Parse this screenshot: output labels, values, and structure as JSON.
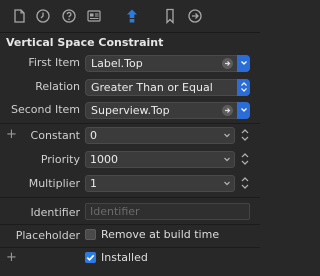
{
  "toolbar": {
    "icons": [
      "file-icon",
      "clock-icon",
      "help-icon",
      "identity-icon",
      "size-icon",
      "attributes-icon",
      "connections-icon"
    ],
    "active": "size-icon",
    "active_color": "#2a7ce0"
  },
  "section": {
    "title": "Vertical Space Constraint"
  },
  "fields": {
    "first_item": {
      "label": "First Item",
      "value": "Label.Top"
    },
    "relation": {
      "label": "Relation",
      "value": "Greater Than or Equal"
    },
    "second_item": {
      "label": "Second Item",
      "value": "Superview.Top"
    },
    "constant": {
      "label": "Constant",
      "value": "0"
    },
    "priority": {
      "label": "Priority",
      "value": "1000"
    },
    "multiplier": {
      "label": "Multiplier",
      "value": "1"
    },
    "identifier": {
      "label": "Identifier",
      "placeholder": "Identifier"
    },
    "placeholder": {
      "label": "Placeholder",
      "checkbox_label": "Remove at build time",
      "checked": false
    },
    "installed": {
      "checkbox_label": "Installed",
      "checked": true
    }
  },
  "colors": {
    "accent": "#2a7ce0",
    "background": "#282828"
  }
}
